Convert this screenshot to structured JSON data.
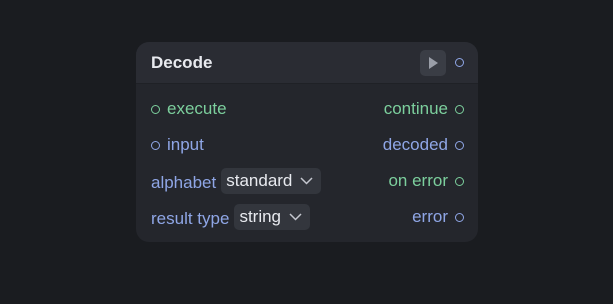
{
  "node": {
    "title": "Decode",
    "run_icon": "play-icon",
    "inputs": [
      {
        "label": "execute",
        "kind": "exec"
      },
      {
        "label": "input",
        "kind": "data"
      }
    ],
    "outputs": [
      {
        "label": "continue",
        "kind": "exec"
      },
      {
        "label": "decoded",
        "kind": "data"
      },
      {
        "label": "on error",
        "kind": "exec"
      },
      {
        "label": "error",
        "kind": "data"
      }
    ],
    "params": [
      {
        "label": "alphabet",
        "value": "standard"
      },
      {
        "label": "result type",
        "value": "string"
      }
    ]
  },
  "colors": {
    "background": "#1a1c20",
    "node": "#24262c",
    "exec_port": "#7ccf9d",
    "data_port": "#8fa6e6",
    "text": "#e8eaef"
  }
}
